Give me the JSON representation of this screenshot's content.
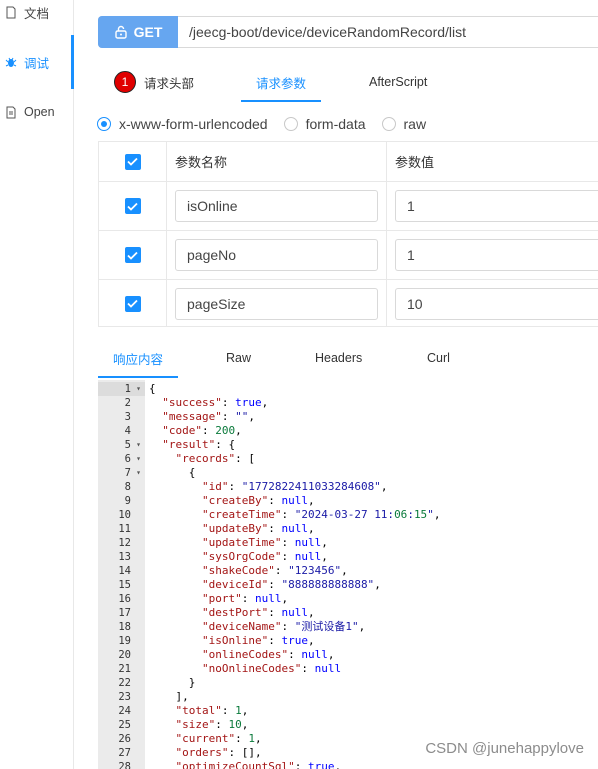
{
  "sidebar": {
    "items": [
      {
        "label": "文档",
        "icon": "doc-icon"
      },
      {
        "label": "调试",
        "icon": "bug-icon"
      },
      {
        "label": "Open",
        "icon": "open-doc-icon"
      }
    ]
  },
  "request": {
    "method": "GET",
    "url": "/jeecg-boot/device/deviceRandomRecord/list"
  },
  "request_tabs": {
    "headers_badge": "1",
    "headers_label": "请求头部",
    "params_label": "请求参数",
    "afterscript_label": "AfterScript"
  },
  "body_types": {
    "urlencoded": "x-www-form-urlencoded",
    "formdata": "form-data",
    "raw": "raw"
  },
  "params_table": {
    "col_name": "参数名称",
    "col_value": "参数值",
    "rows": [
      {
        "name": "isOnline",
        "value": "1"
      },
      {
        "name": "pageNo",
        "value": "1"
      },
      {
        "name": "pageSize",
        "value": "10"
      }
    ]
  },
  "response_tabs": {
    "content": "响应内容",
    "raw": "Raw",
    "headers": "Headers",
    "curl": "Curl"
  },
  "response_lines": [
    "{",
    "  \"success\": true,",
    "  \"message\": \"\",",
    "  \"code\": 200,",
    "  \"result\": {",
    "    \"records\": [",
    "      {",
    "        \"id\": \"1772822411033284608\",",
    "        \"createBy\": null,",
    "        \"createTime\": \"2024-03-27 11:06:15\",",
    "        \"updateBy\": null,",
    "        \"updateTime\": null,",
    "        \"sysOrgCode\": null,",
    "        \"shakeCode\": \"123456\",",
    "        \"deviceId\": \"888888888888\",",
    "        \"port\": null,",
    "        \"destPort\": null,",
    "        \"deviceName\": \"测试设备1\",",
    "        \"isOnline\": true,",
    "        \"onlineCodes\": null,",
    "        \"noOnlineCodes\": null",
    "      }",
    "    ],",
    "    \"total\": 1,",
    "    \"size\": 10,",
    "    \"current\": 1,",
    "    \"orders\": [],",
    "    \"optimizeCountSql\": true,"
  ],
  "fold_lines": [
    1,
    5,
    6,
    7
  ],
  "watermark": "CSDN @junehappylove",
  "colors": {
    "accent": "#1890ff",
    "method_button": "#66a6f0",
    "badge": "#e00000",
    "json_key": "#a31515",
    "json_string": "#1a1aa6",
    "json_number": "#0a7a3b",
    "json_literal": "#0000ff"
  }
}
